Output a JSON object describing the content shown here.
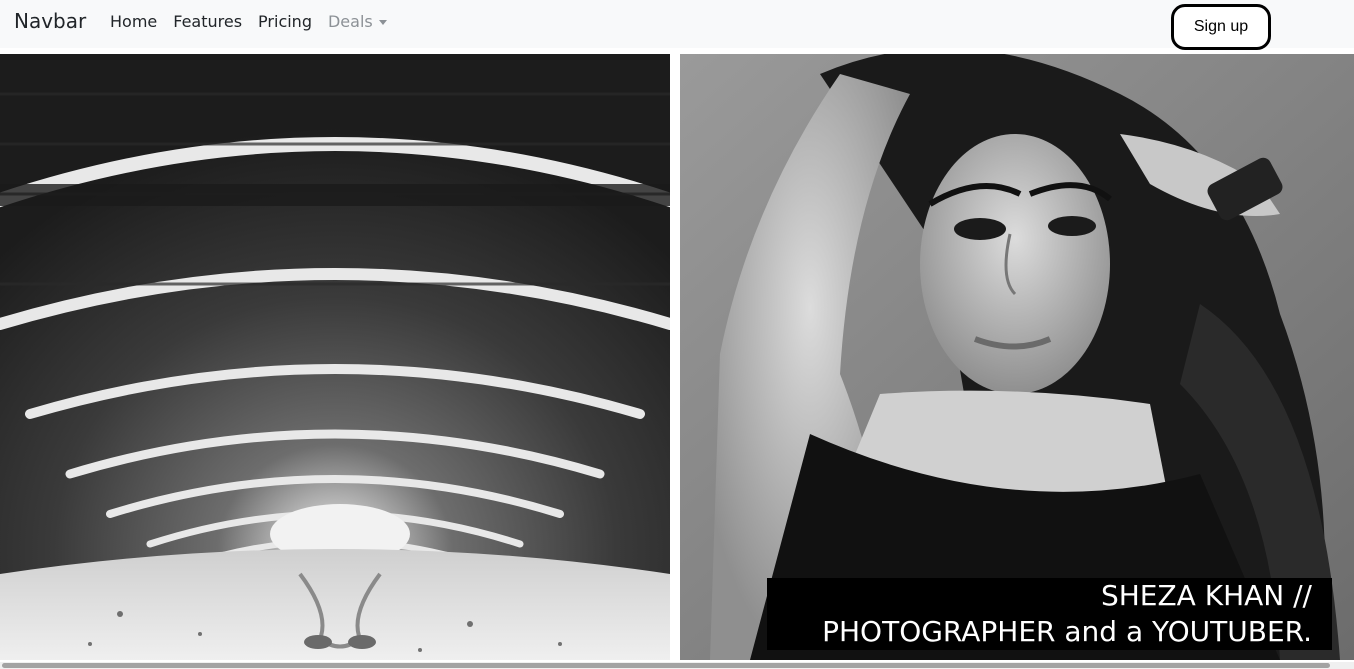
{
  "navbar": {
    "brand": "Navbar",
    "links": [
      {
        "label": "Home"
      },
      {
        "label": "Features"
      },
      {
        "label": "Pricing"
      }
    ],
    "dropdown": {
      "label": "Deals"
    },
    "signup_label": "Sign up"
  },
  "hero": {
    "caption_line1": "SHEZA KHAN //",
    "caption_line2": "PHOTOGRAPHER and a YOUTUBER."
  },
  "colors": {
    "navbar_bg": "#f8f9fa",
    "caption_bg": "#000000",
    "caption_text": "#ffffff"
  }
}
